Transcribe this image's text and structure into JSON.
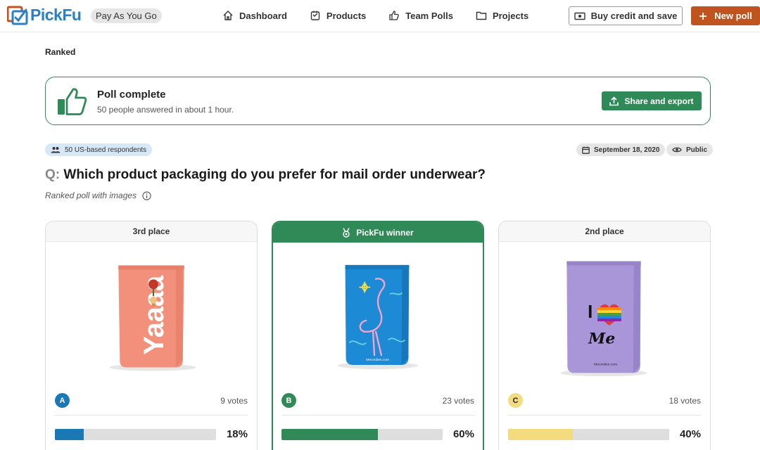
{
  "brand": {
    "name": "PickFu",
    "plan": "Pay As You Go"
  },
  "nav": {
    "items": [
      {
        "label": "Dashboard",
        "icon": "home-icon"
      },
      {
        "label": "Products",
        "icon": "box-icon"
      },
      {
        "label": "Team Polls",
        "icon": "thumbs-up-icon"
      },
      {
        "label": "Projects",
        "icon": "folder-icon"
      }
    ],
    "buy_label": "Buy credit and save",
    "new_label": "New poll"
  },
  "page": {
    "poll_type": "Ranked",
    "banner": {
      "title": "Poll complete",
      "subtitle": "50 people answered in about 1 hour.",
      "share_label": "Share and export"
    },
    "respondents": "50 US-based respondents",
    "date": "September 18, 2020",
    "visibility": "Public",
    "question_prefix": "Q:",
    "question": "Which product packaging do you prefer for mail order underwear?",
    "subtitle": "Ranked poll with images"
  },
  "options": [
    {
      "place": "3rd place",
      "letter": "A",
      "votes": "9 votes",
      "percent": "18%",
      "share": 0.18,
      "color": "#1a78b4",
      "winner": false
    },
    {
      "place": "PickFu winner",
      "letter": "B",
      "votes": "23 votes",
      "percent": "60%",
      "share": 0.6,
      "color": "#2f8a57",
      "winner": true
    },
    {
      "place": "2nd place",
      "letter": "C",
      "votes": "18 votes",
      "percent": "40%",
      "share": 0.4,
      "color": "#f4dc7e",
      "winner": false
    }
  ],
  "colors": {
    "accent": "#c0541e",
    "success": "#2f8a57",
    "brand_blue": "#2a7fc5"
  }
}
